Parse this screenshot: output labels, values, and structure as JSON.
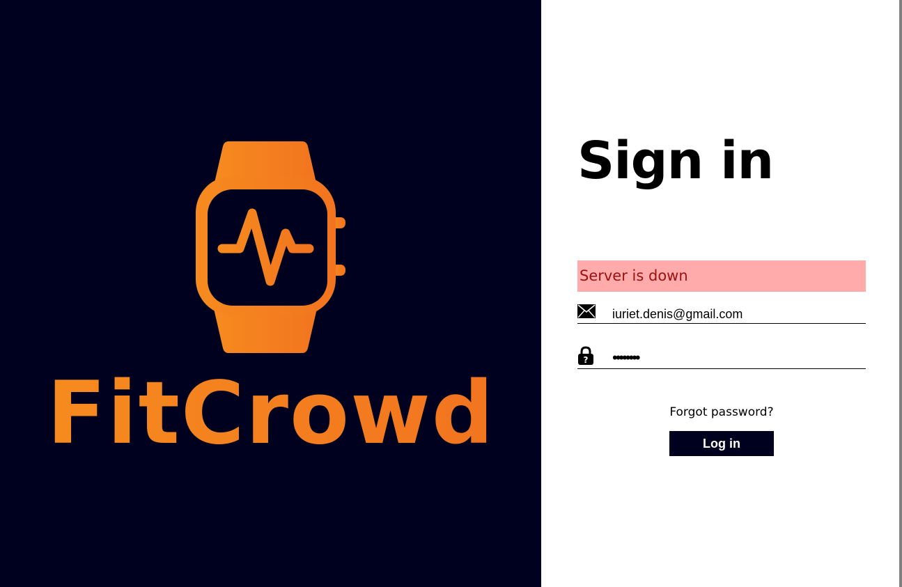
{
  "brand": {
    "name": "FitCrowd",
    "bg_color": "#00001f",
    "accent_color": "#f68b1f",
    "accent_color_dark": "#f2741f"
  },
  "signin": {
    "title": "Sign in",
    "error_message": "Server is down",
    "email_icon": "envelope-icon",
    "email_value": "iuriet.denis@gmail.com",
    "password_icon": "padlock-icon",
    "password_value": "********",
    "forgot_password_label": "Forgot password?",
    "login_label": "Log in"
  },
  "colors": {
    "error_bg": "#ffabab",
    "error_text": "#9b1111",
    "button_bg": "#00001f",
    "button_text": "#ffffff"
  }
}
